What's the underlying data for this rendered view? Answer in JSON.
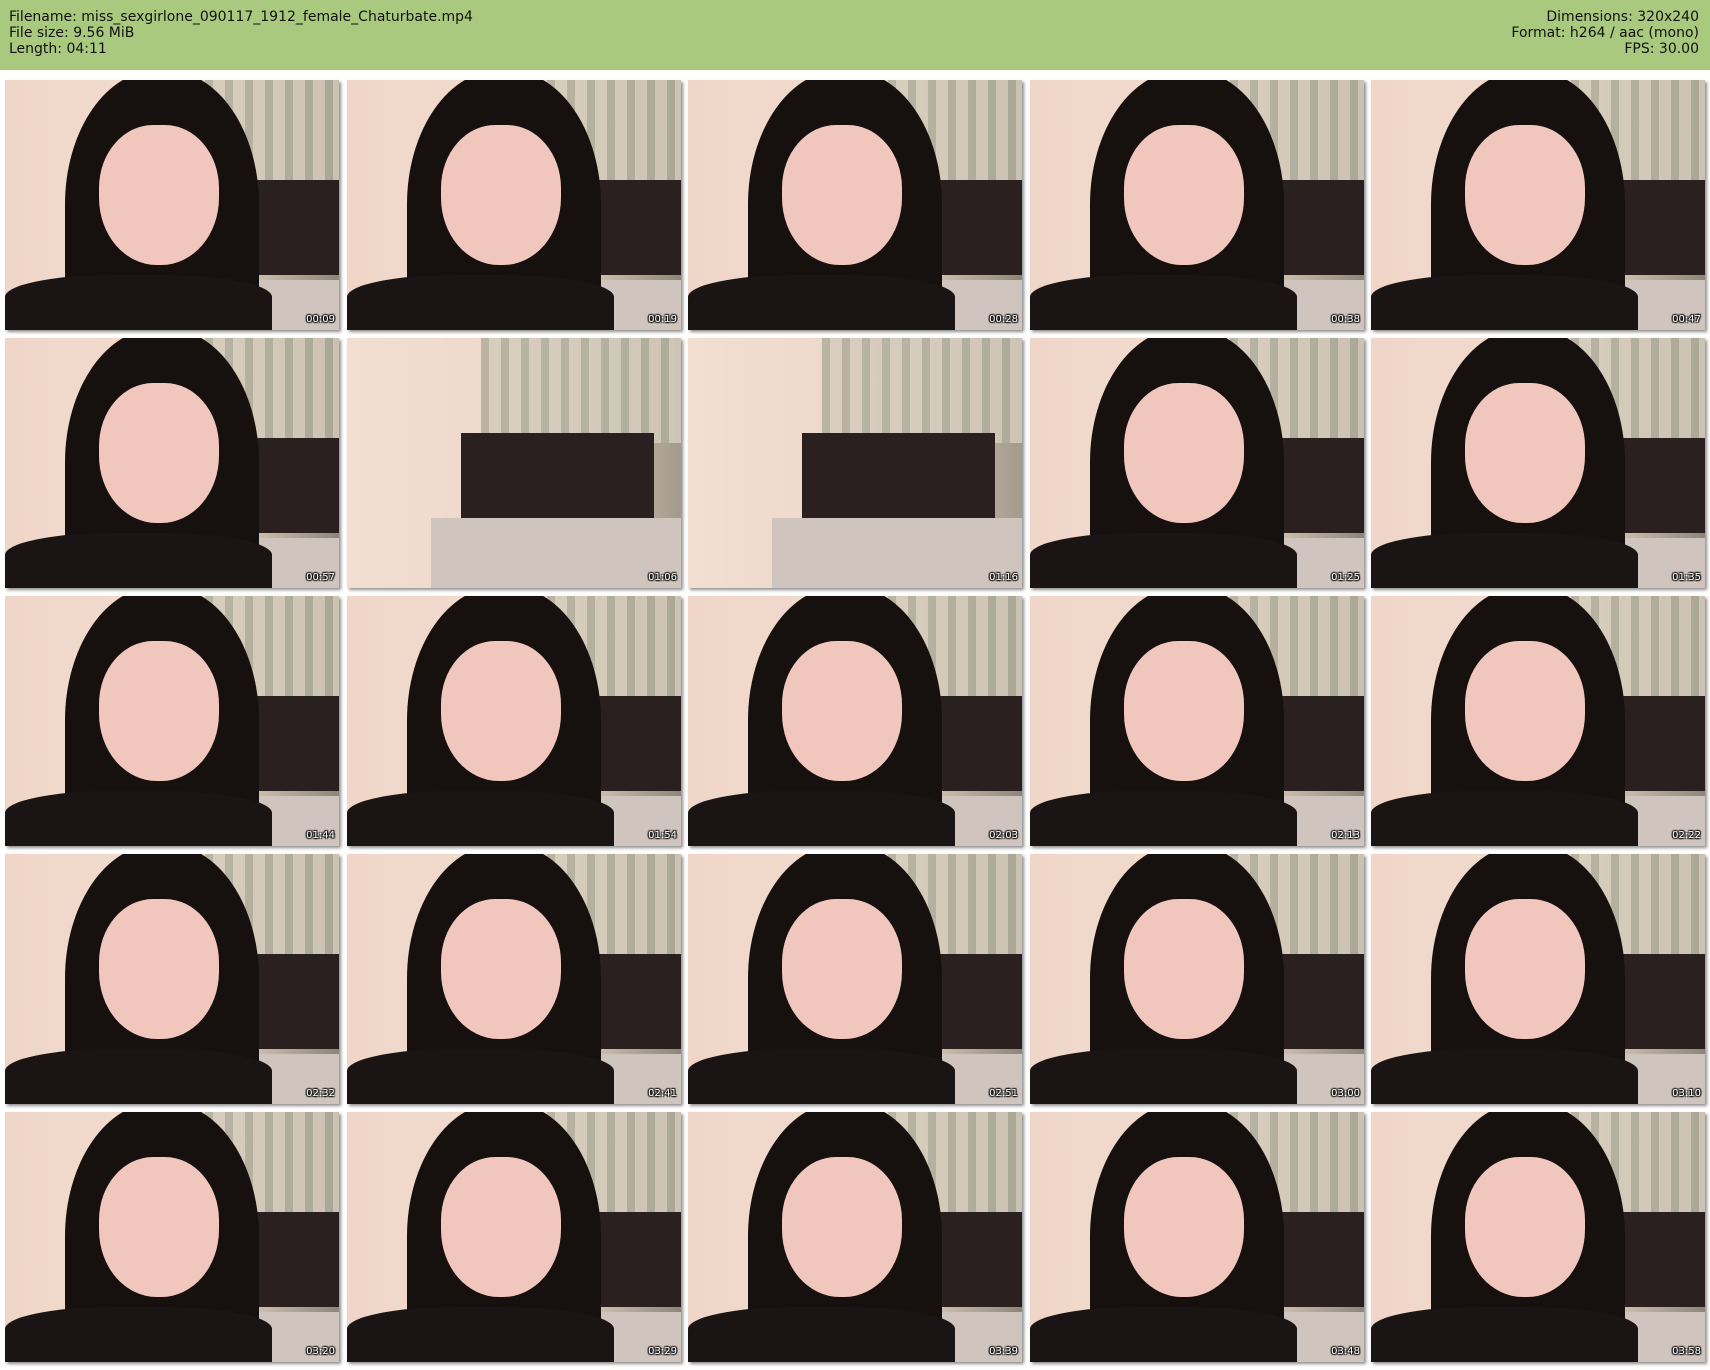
{
  "header": {
    "filename_line": "Filename: miss_sexgirlone_090117_1912_female_Chaturbate.mp4",
    "filesize_line": "File size: 9.56 MiB",
    "length_line": "Length: 04:11",
    "dimensions_line": "Dimensions: 320x240",
    "format_line": "Format: h264 / aac (mono)",
    "fps_line": "FPS: 30.00"
  },
  "colors": {
    "header_bg": "#a9c97e",
    "page_bg": "#ffffff",
    "timestamp_text": "#ffffff"
  },
  "thumbnails": [
    {
      "ts": "00:09",
      "scene": "person"
    },
    {
      "ts": "00:19",
      "scene": "person"
    },
    {
      "ts": "00:28",
      "scene": "person"
    },
    {
      "ts": "00:38",
      "scene": "person"
    },
    {
      "ts": "00:47",
      "scene": "person"
    },
    {
      "ts": "00:57",
      "scene": "person"
    },
    {
      "ts": "01:06",
      "scene": "room"
    },
    {
      "ts": "01:16",
      "scene": "room"
    },
    {
      "ts": "01:25",
      "scene": "person"
    },
    {
      "ts": "01:35",
      "scene": "person"
    },
    {
      "ts": "01:44",
      "scene": "person"
    },
    {
      "ts": "01:54",
      "scene": "person"
    },
    {
      "ts": "02:03",
      "scene": "person"
    },
    {
      "ts": "02:13",
      "scene": "person"
    },
    {
      "ts": "02:22",
      "scene": "person"
    },
    {
      "ts": "02:32",
      "scene": "person"
    },
    {
      "ts": "02:41",
      "scene": "person"
    },
    {
      "ts": "02:51",
      "scene": "person"
    },
    {
      "ts": "03:00",
      "scene": "person"
    },
    {
      "ts": "03:10",
      "scene": "person"
    },
    {
      "ts": "03:20",
      "scene": "person"
    },
    {
      "ts": "03:29",
      "scene": "person"
    },
    {
      "ts": "03:39",
      "scene": "person"
    },
    {
      "ts": "03:48",
      "scene": "person"
    },
    {
      "ts": "03:58",
      "scene": "person"
    }
  ]
}
